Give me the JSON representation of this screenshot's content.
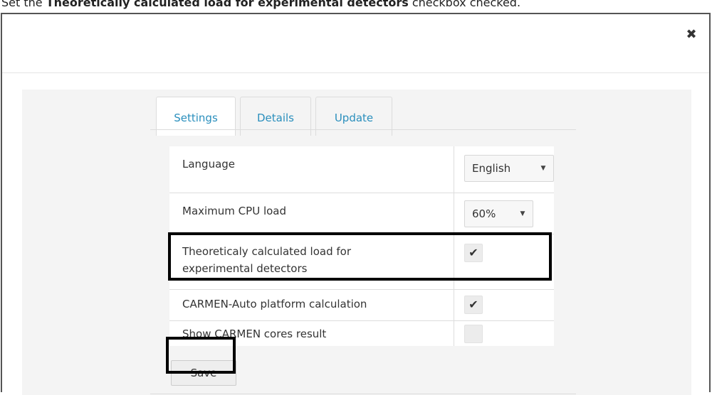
{
  "caption": {
    "prefix": "Set the ",
    "bold": "Theoretically calculated load for experimental detectors",
    "suffix": " checkbox checked."
  },
  "dialog": {
    "close_icon": "close-icon",
    "close_glyph": "✖",
    "tabs": [
      {
        "label": "Settings",
        "active": true
      },
      {
        "label": "Details",
        "active": false
      },
      {
        "label": "Update",
        "active": false
      }
    ],
    "settings": {
      "language_label": "Language",
      "language_value": "English",
      "cpu_label": "Maximum CPU load",
      "cpu_value": "60%",
      "theoretical_label": "Theoreticaly calculated load for experimental detectors",
      "theoretical_checked": true,
      "carmen_auto_label": "CARMEN-Auto platform calculation",
      "carmen_auto_checked": true,
      "carmen_cores_label": "Show CARMEN cores result",
      "carmen_cores_checked": false,
      "check_glyph": "✔",
      "caret_glyph": "▼"
    },
    "save_label": "Save"
  }
}
